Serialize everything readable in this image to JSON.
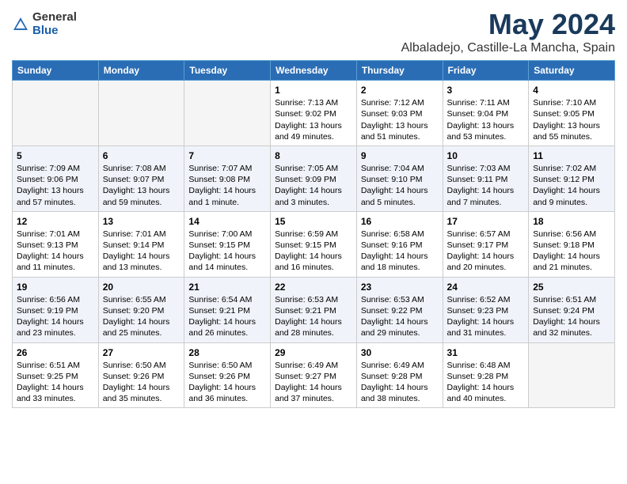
{
  "logo": {
    "general": "General",
    "blue": "Blue"
  },
  "title": "May 2024",
  "subtitle": "Albaladejo, Castille-La Mancha, Spain",
  "days_header": [
    "Sunday",
    "Monday",
    "Tuesday",
    "Wednesday",
    "Thursday",
    "Friday",
    "Saturday"
  ],
  "weeks": [
    [
      {
        "num": "",
        "empty": true
      },
      {
        "num": "",
        "empty": true
      },
      {
        "num": "",
        "empty": true
      },
      {
        "num": "1",
        "sunrise": "Sunrise: 7:13 AM",
        "sunset": "Sunset: 9:02 PM",
        "daylight": "Daylight: 13 hours and 49 minutes."
      },
      {
        "num": "2",
        "sunrise": "Sunrise: 7:12 AM",
        "sunset": "Sunset: 9:03 PM",
        "daylight": "Daylight: 13 hours and 51 minutes."
      },
      {
        "num": "3",
        "sunrise": "Sunrise: 7:11 AM",
        "sunset": "Sunset: 9:04 PM",
        "daylight": "Daylight: 13 hours and 53 minutes."
      },
      {
        "num": "4",
        "sunrise": "Sunrise: 7:10 AM",
        "sunset": "Sunset: 9:05 PM",
        "daylight": "Daylight: 13 hours and 55 minutes."
      }
    ],
    [
      {
        "num": "5",
        "sunrise": "Sunrise: 7:09 AM",
        "sunset": "Sunset: 9:06 PM",
        "daylight": "Daylight: 13 hours and 57 minutes."
      },
      {
        "num": "6",
        "sunrise": "Sunrise: 7:08 AM",
        "sunset": "Sunset: 9:07 PM",
        "daylight": "Daylight: 13 hours and 59 minutes."
      },
      {
        "num": "7",
        "sunrise": "Sunrise: 7:07 AM",
        "sunset": "Sunset: 9:08 PM",
        "daylight": "Daylight: 14 hours and 1 minute."
      },
      {
        "num": "8",
        "sunrise": "Sunrise: 7:05 AM",
        "sunset": "Sunset: 9:09 PM",
        "daylight": "Daylight: 14 hours and 3 minutes."
      },
      {
        "num": "9",
        "sunrise": "Sunrise: 7:04 AM",
        "sunset": "Sunset: 9:10 PM",
        "daylight": "Daylight: 14 hours and 5 minutes."
      },
      {
        "num": "10",
        "sunrise": "Sunrise: 7:03 AM",
        "sunset": "Sunset: 9:11 PM",
        "daylight": "Daylight: 14 hours and 7 minutes."
      },
      {
        "num": "11",
        "sunrise": "Sunrise: 7:02 AM",
        "sunset": "Sunset: 9:12 PM",
        "daylight": "Daylight: 14 hours and 9 minutes."
      }
    ],
    [
      {
        "num": "12",
        "sunrise": "Sunrise: 7:01 AM",
        "sunset": "Sunset: 9:13 PM",
        "daylight": "Daylight: 14 hours and 11 minutes."
      },
      {
        "num": "13",
        "sunrise": "Sunrise: 7:01 AM",
        "sunset": "Sunset: 9:14 PM",
        "daylight": "Daylight: 14 hours and 13 minutes."
      },
      {
        "num": "14",
        "sunrise": "Sunrise: 7:00 AM",
        "sunset": "Sunset: 9:15 PM",
        "daylight": "Daylight: 14 hours and 14 minutes."
      },
      {
        "num": "15",
        "sunrise": "Sunrise: 6:59 AM",
        "sunset": "Sunset: 9:15 PM",
        "daylight": "Daylight: 14 hours and 16 minutes."
      },
      {
        "num": "16",
        "sunrise": "Sunrise: 6:58 AM",
        "sunset": "Sunset: 9:16 PM",
        "daylight": "Daylight: 14 hours and 18 minutes."
      },
      {
        "num": "17",
        "sunrise": "Sunrise: 6:57 AM",
        "sunset": "Sunset: 9:17 PM",
        "daylight": "Daylight: 14 hours and 20 minutes."
      },
      {
        "num": "18",
        "sunrise": "Sunrise: 6:56 AM",
        "sunset": "Sunset: 9:18 PM",
        "daylight": "Daylight: 14 hours and 21 minutes."
      }
    ],
    [
      {
        "num": "19",
        "sunrise": "Sunrise: 6:56 AM",
        "sunset": "Sunset: 9:19 PM",
        "daylight": "Daylight: 14 hours and 23 minutes."
      },
      {
        "num": "20",
        "sunrise": "Sunrise: 6:55 AM",
        "sunset": "Sunset: 9:20 PM",
        "daylight": "Daylight: 14 hours and 25 minutes."
      },
      {
        "num": "21",
        "sunrise": "Sunrise: 6:54 AM",
        "sunset": "Sunset: 9:21 PM",
        "daylight": "Daylight: 14 hours and 26 minutes."
      },
      {
        "num": "22",
        "sunrise": "Sunrise: 6:53 AM",
        "sunset": "Sunset: 9:21 PM",
        "daylight": "Daylight: 14 hours and 28 minutes."
      },
      {
        "num": "23",
        "sunrise": "Sunrise: 6:53 AM",
        "sunset": "Sunset: 9:22 PM",
        "daylight": "Daylight: 14 hours and 29 minutes."
      },
      {
        "num": "24",
        "sunrise": "Sunrise: 6:52 AM",
        "sunset": "Sunset: 9:23 PM",
        "daylight": "Daylight: 14 hours and 31 minutes."
      },
      {
        "num": "25",
        "sunrise": "Sunrise: 6:51 AM",
        "sunset": "Sunset: 9:24 PM",
        "daylight": "Daylight: 14 hours and 32 minutes."
      }
    ],
    [
      {
        "num": "26",
        "sunrise": "Sunrise: 6:51 AM",
        "sunset": "Sunset: 9:25 PM",
        "daylight": "Daylight: 14 hours and 33 minutes."
      },
      {
        "num": "27",
        "sunrise": "Sunrise: 6:50 AM",
        "sunset": "Sunset: 9:26 PM",
        "daylight": "Daylight: 14 hours and 35 minutes."
      },
      {
        "num": "28",
        "sunrise": "Sunrise: 6:50 AM",
        "sunset": "Sunset: 9:26 PM",
        "daylight": "Daylight: 14 hours and 36 minutes."
      },
      {
        "num": "29",
        "sunrise": "Sunrise: 6:49 AM",
        "sunset": "Sunset: 9:27 PM",
        "daylight": "Daylight: 14 hours and 37 minutes."
      },
      {
        "num": "30",
        "sunrise": "Sunrise: 6:49 AM",
        "sunset": "Sunset: 9:28 PM",
        "daylight": "Daylight: 14 hours and 38 minutes."
      },
      {
        "num": "31",
        "sunrise": "Sunrise: 6:48 AM",
        "sunset": "Sunset: 9:28 PM",
        "daylight": "Daylight: 14 hours and 40 minutes."
      },
      {
        "num": "",
        "empty": true
      }
    ]
  ]
}
